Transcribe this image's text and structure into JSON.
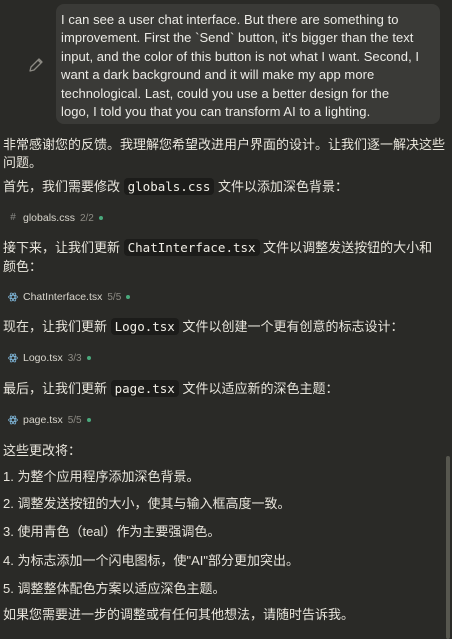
{
  "user_message": {
    "lines": [
      "I can see a user chat interface. But there are something to",
      "improvement. First the `Send` button, it's bigger than the text",
      "input, and the color of this button is not what I want. Second, I",
      "want a dark background and it will make my app more",
      "technological. Last, could you use a better design for the",
      "logo, I told you that you can transform AI to a lighting."
    ]
  },
  "assistant": {
    "intro_1": "非常感谢您的反馈。我理解您希望改进用户界面的设计。让我们逐一解决这些",
    "intro_2": "问题。",
    "step1": {
      "before": "首先，我们需要修改 ",
      "code": "globals.css",
      "after": " 文件以添加深色背景："
    },
    "file1": {
      "name": "globals.css",
      "version": "2/2",
      "icon": "hash-icon"
    },
    "step2": {
      "line1_before": "接下来，让我们更新 ",
      "code": "ChatInterface.tsx",
      "line1_after": " 文件以调整发送按钮的大小和",
      "line2": "颜色："
    },
    "file2": {
      "name": "ChatInterface.tsx",
      "version": "5/5",
      "icon": "react-icon"
    },
    "step3": {
      "before": "现在，让我们更新 ",
      "code": "Logo.tsx",
      "after": " 文件以创建一个更有创意的标志设计："
    },
    "file3": {
      "name": "Logo.tsx",
      "version": "3/3",
      "icon": "react-icon"
    },
    "step4": {
      "before": "最后，让我们更新 ",
      "code": "page.tsx",
      "after": " 文件以适应新的深色主题："
    },
    "file4": {
      "name": "page.tsx",
      "version": "5/5",
      "icon": "react-icon"
    },
    "changes_intro": "这些更改将：",
    "changes": [
      "1. 为整个应用程序添加深色背景。",
      "2. 调整发送按钮的大小，使其与输入框高度一致。",
      "3. 使用青色（teal）作为主要强调色。",
      "4. 为标志添加一个闪电图标，使\"AI\"部分更加突出。",
      "5. 调整整体配色方案以适应深色主题。"
    ],
    "closing": "如果您需要进一步的调整或有任何其他想法，请随时告诉我。"
  },
  "colors": {
    "background": "#2a2a27",
    "bubble": "#3a3a37",
    "status_dot": "#4aa97c"
  }
}
